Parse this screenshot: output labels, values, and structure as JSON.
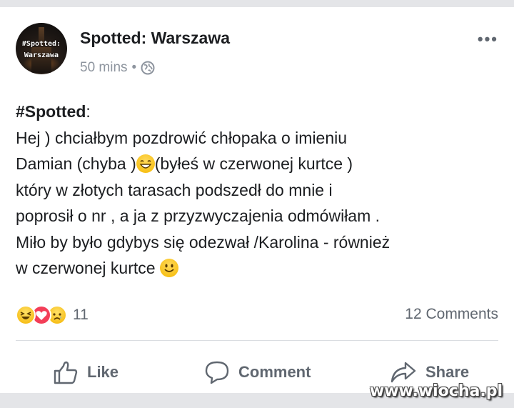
{
  "post": {
    "page_name": "Spotted: Warszawa",
    "time": "50 mins",
    "separator": "•",
    "privacy_icon": "globe-icon",
    "more_label": "•••",
    "avatar_text_line1": "#Spotted:",
    "avatar_text_line2": "Warszawa",
    "hashtag": "#Spotted",
    "hashtag_suffix": ":",
    "line1": "Hej ) chciałbym pozdrowić chłopaka o imieniu",
    "line2a": "Damian (chyba )",
    "line2b": "(byłeś w czerwonej kurtce )",
    "line3": "który w złotych tarasach podszedł do mnie i",
    "line4": "poprosił o nr , a ja z przyzwyczajenia odmówiłam .",
    "line5": "Miło by było gdybys się odezwał /Karolina - również",
    "line6": "w czerwonej kurtce ",
    "emoji1": "grinning-squint-emoji",
    "emoji2": "smiling-face-emoji"
  },
  "stats": {
    "reactions": [
      "haha",
      "love",
      "sad"
    ],
    "reaction_count": "11",
    "comments": "12 Comments"
  },
  "actions": {
    "like": "Like",
    "comment": "Comment",
    "share": "Share"
  },
  "watermark": "www.wiocha.pl",
  "colors": {
    "text": "#1c1e21",
    "muted": "#606770",
    "love": "#f33e58",
    "emoji": "#f5b800"
  }
}
